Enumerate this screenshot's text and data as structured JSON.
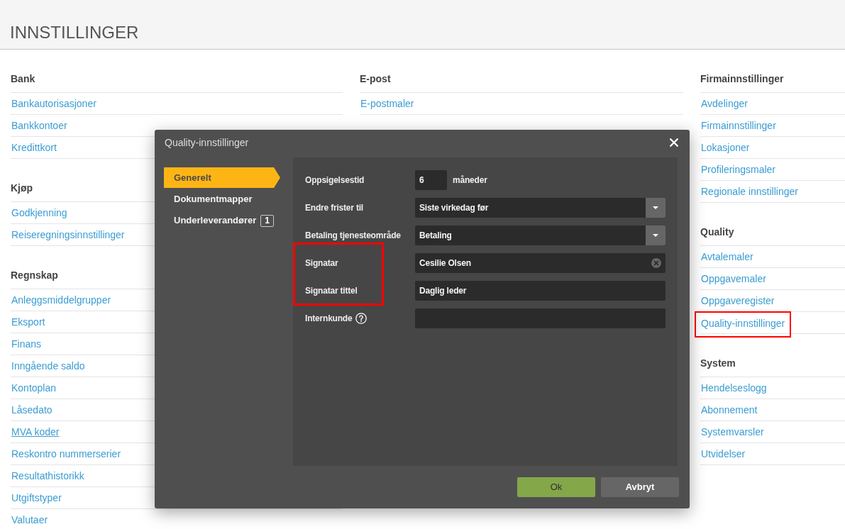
{
  "page": {
    "title": "INNSTILLINGER"
  },
  "columns": [
    {
      "sections": [
        {
          "heading": "Bank",
          "links": [
            {
              "label": "Bankautorisasjoner",
              "hovered": false,
              "highlighted": false
            },
            {
              "label": "Bankkontoer",
              "hovered": false,
              "highlighted": false
            },
            {
              "label": "Kredittkort",
              "hovered": false,
              "highlighted": false
            }
          ]
        },
        {
          "heading": "Kjøp",
          "links": [
            {
              "label": "Godkjenning",
              "hovered": false,
              "highlighted": false
            },
            {
              "label": "Reiseregningsinnstillinger",
              "hovered": false,
              "highlighted": false
            }
          ]
        },
        {
          "heading": "Regnskap",
          "links": [
            {
              "label": "Anleggsmiddelgrupper",
              "hovered": false,
              "highlighted": false
            },
            {
              "label": "Eksport",
              "hovered": false,
              "highlighted": false
            },
            {
              "label": "Finans",
              "hovered": false,
              "highlighted": false
            },
            {
              "label": "Inngående saldo",
              "hovered": false,
              "highlighted": false
            },
            {
              "label": "Kontoplan",
              "hovered": false,
              "highlighted": false
            },
            {
              "label": "Låsedato",
              "hovered": false,
              "highlighted": false
            },
            {
              "label": "MVA koder",
              "hovered": true,
              "highlighted": false
            },
            {
              "label": "Reskontro nummerserier",
              "hovered": false,
              "highlighted": false
            },
            {
              "label": "Resultathistorikk",
              "hovered": false,
              "highlighted": false
            },
            {
              "label": "Utgiftstyper",
              "hovered": false,
              "highlighted": false
            },
            {
              "label": "Valutaer",
              "hovered": false,
              "highlighted": false
            }
          ]
        }
      ]
    },
    {
      "sections": [
        {
          "heading": "E-post",
          "links": [
            {
              "label": "E-postmaler",
              "hovered": false,
              "highlighted": false
            }
          ]
        }
      ]
    },
    {
      "sections": [
        {
          "heading": "Firmainnstillinger",
          "links": [
            {
              "label": "Avdelinger",
              "hovered": false,
              "highlighted": false
            },
            {
              "label": "Firmainnstillinger",
              "hovered": false,
              "highlighted": false
            },
            {
              "label": "Lokasjoner",
              "hovered": false,
              "highlighted": false
            },
            {
              "label": "Profileringsmaler",
              "hovered": false,
              "highlighted": false
            },
            {
              "label": "Regionale innstillinger",
              "hovered": false,
              "highlighted": false
            }
          ]
        },
        {
          "heading": "Quality",
          "links": [
            {
              "label": "Avtalemaler",
              "hovered": false,
              "highlighted": false
            },
            {
              "label": "Oppgavemaler",
              "hovered": false,
              "highlighted": false
            },
            {
              "label": "Oppgaveregister",
              "hovered": false,
              "highlighted": false
            },
            {
              "label": "Quality-innstillinger",
              "hovered": false,
              "highlighted": true
            }
          ]
        },
        {
          "heading": "System",
          "links": [
            {
              "label": "Hendelseslogg",
              "hovered": false,
              "highlighted": false
            },
            {
              "label": "Abonnement",
              "hovered": false,
              "highlighted": false
            },
            {
              "label": "Systemvarsler",
              "hovered": false,
              "highlighted": false
            },
            {
              "label": "Utvidelser",
              "hovered": false,
              "highlighted": false
            }
          ]
        }
      ]
    }
  ],
  "dialog": {
    "title": "Quality-innstillinger",
    "nav": [
      {
        "label": "Generelt",
        "selected": true
      },
      {
        "label": "Dokumentmapper",
        "selected": false
      },
      {
        "label": "Underleverandører",
        "count": "1",
        "selected": false
      }
    ],
    "fields": [
      {
        "kind": "number",
        "label": "Oppsigelsestid",
        "value": "6",
        "unit": "måneder",
        "help": false,
        "highlighted": false
      },
      {
        "kind": "select",
        "label": "Endre frister til",
        "value": "Siste virkedag før",
        "help": false,
        "highlighted": false
      },
      {
        "kind": "select",
        "label": "Betaling tjenesteområde",
        "value": "Betaling",
        "help": false,
        "highlighted": false
      },
      {
        "kind": "clearable",
        "label": "Signatar",
        "value": "Cesilie Olsen",
        "help": false,
        "highlighted": true
      },
      {
        "kind": "text",
        "label": "Signatar tittel",
        "value": "Daglig leder",
        "help": false,
        "highlighted": true
      },
      {
        "kind": "text",
        "label": "Internkunde",
        "help": true,
        "highlighted": false
      }
    ],
    "buttons": [
      {
        "label": "Ok",
        "kind": "primary"
      },
      {
        "label": "Avbryt",
        "kind": "secondary"
      }
    ]
  }
}
